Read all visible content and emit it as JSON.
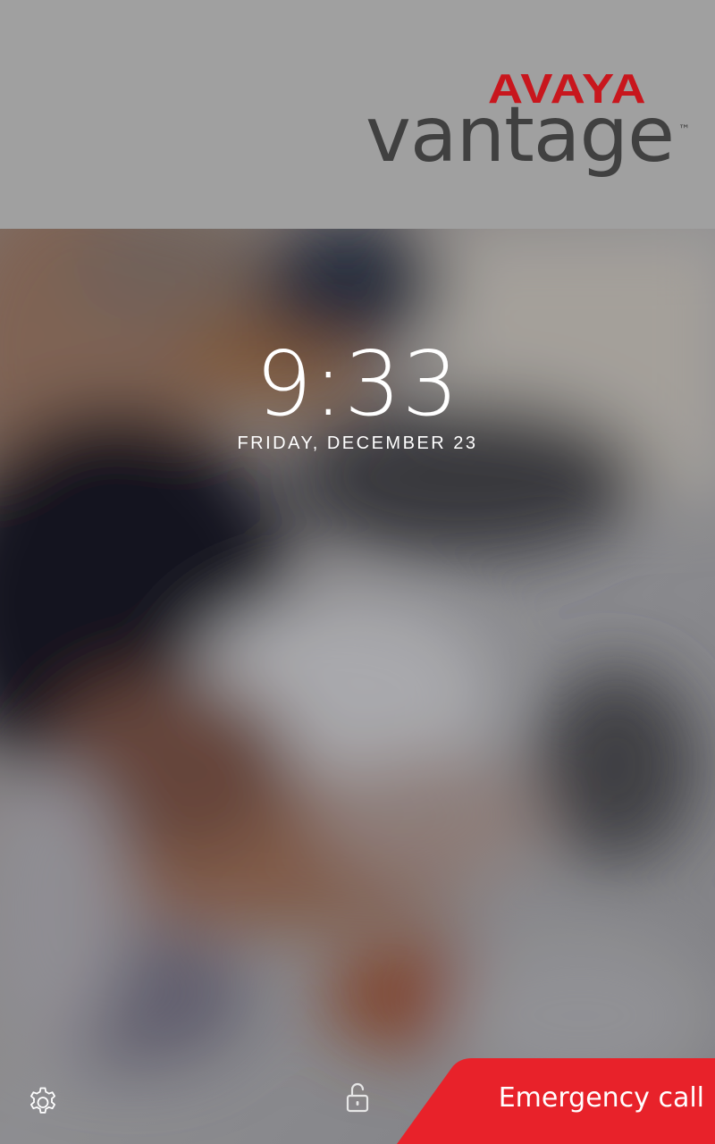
{
  "header": {
    "brand": "AVAYA",
    "product": "vantage",
    "trademark": "™"
  },
  "lockscreen": {
    "time": "9:33",
    "date": "FRIDAY, DECEMBER 23"
  },
  "controls": {
    "settings_icon": "gear-icon",
    "lock_icon": "unlocked-padlock-icon",
    "emergency_label": "Emergency call"
  },
  "colors": {
    "brand_red": "#c8161d",
    "emergency_red": "#e8222a",
    "header_bg": "#a0a0a0",
    "logo_gray": "#404040"
  }
}
